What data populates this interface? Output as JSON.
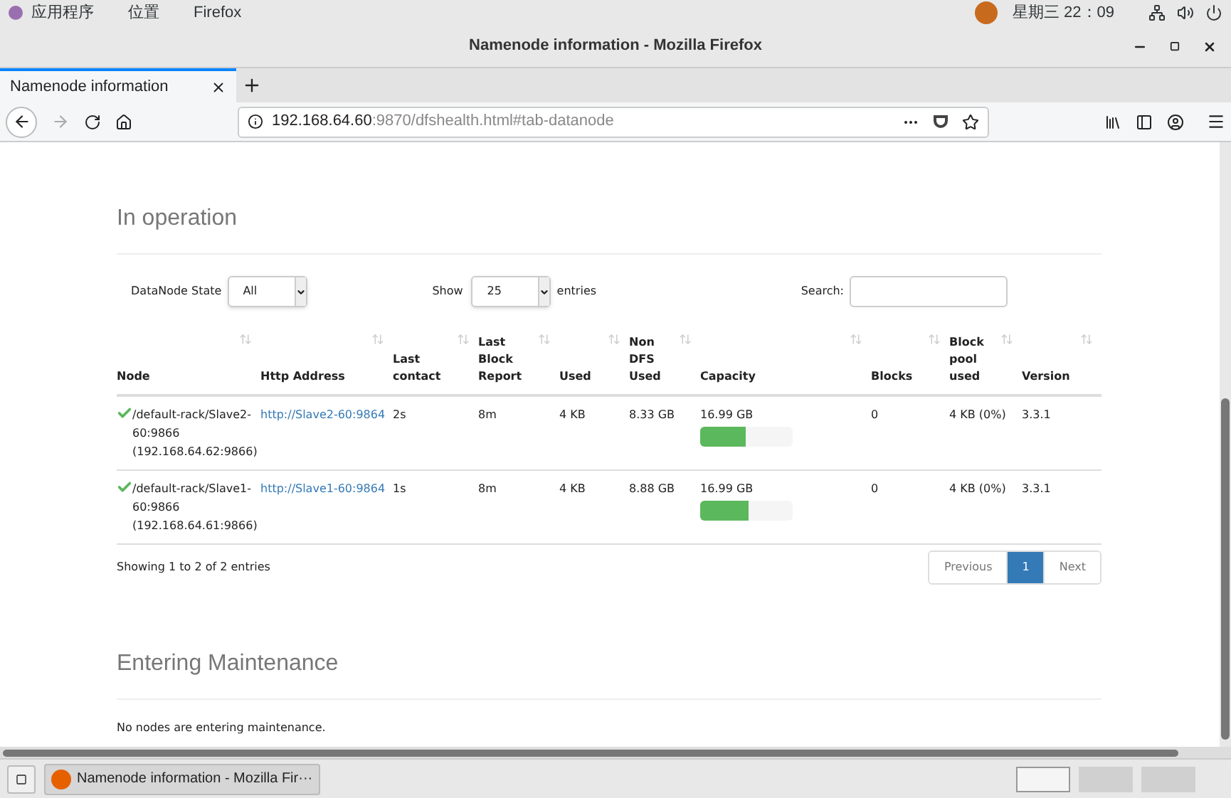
{
  "top_bar": {
    "menus": [
      "应用程序",
      "位置",
      "Firefox"
    ],
    "clock": "星期三 22：09"
  },
  "window": {
    "title": "Namenode information - Mozilla Firefox"
  },
  "tabs": [
    {
      "label": "Namenode information",
      "selected": true
    }
  ],
  "address_bar": {
    "host": "192.168.64.60",
    "path": ":9870/dfshealth.html#tab-datanode"
  },
  "in_operation": {
    "heading": "In operation",
    "state_filter": {
      "label": "DataNode State",
      "value": "All"
    },
    "page_length": {
      "label_before": "Show",
      "value": "25",
      "label_after": "entries"
    },
    "search": {
      "label": "Search:"
    },
    "table": {
      "columns": [
        "Node",
        "Http Address",
        "Last contact",
        "Last Block Report",
        "Used",
        "Non DFS Used",
        "Capacity",
        "Blocks",
        "Block pool used",
        "Version"
      ],
      "rows": [
        {
          "node": "/default-rack/Slave2-60:9866 (192.168.64.62:9866)",
          "http_address": "http://Slave2-60:9864",
          "last_contact": "2s",
          "last_block_report": "8m",
          "used": "4 KB",
          "non_dfs_used": "8.33 GB",
          "capacity": "16.99 GB",
          "level": 0.49,
          "blocks": "0",
          "block_pool_used": "4 KB (0%)",
          "version": "3.3.1"
        },
        {
          "node": "/default-rack/Slave1-60:9866 (192.168.64.61:9866)",
          "http_address": "http://Slave1-60:9864",
          "last_contact": "1s",
          "last_block_report": "8m",
          "used": "4 KB",
          "non_dfs_used": "8.88 GB",
          "capacity": "16.99 GB",
          "level": 0.52,
          "blocks": "0",
          "block_pool_used": "4 KB (0%)",
          "version": "3.3.1"
        }
      ]
    },
    "info": "Showing 1 to 2 of 2 entries",
    "pagination": [
      {
        "label": "Previous",
        "selected": false
      },
      {
        "label": "1",
        "selected": true
      },
      {
        "label": "Next",
        "selected": false
      }
    ]
  },
  "entering_maintenance": {
    "heading": "Entering Maintenance",
    "message": "No nodes are entering maintenance."
  },
  "taskbar": {
    "window_button": "Namenode information - Mozilla Fir···"
  }
}
